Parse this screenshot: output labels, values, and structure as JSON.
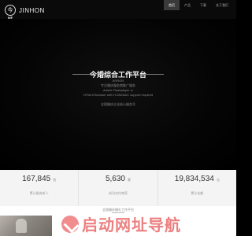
{
  "header": {
    "logo_mark": "今婚",
    "logo_text": "JINHON",
    "nav": [
      "首页",
      "产品",
      "下载",
      "关于我们"
    ]
  },
  "hero": {
    "title": "今婚综合工作平台",
    "lines": [
      "ERROR",
      "专注婚庆服务商推广服务",
      "Adobe Flashplayer or",
      "HTML5 Browser with H.264/AAC support required",
      "",
      "全国婚庆企业核心服务号"
    ]
  },
  "stats": [
    {
      "value": "167,845",
      "unit": "名",
      "label": "累计服务新人"
    },
    {
      "value": "5,630",
      "unit": "家",
      "label": "成功合作商家"
    },
    {
      "value": "19,834,534",
      "unit": "元",
      "label": "累计金额"
    }
  ],
  "section": {
    "title": "全国婚庆婚礼工作平台"
  },
  "watermark": {
    "text": "启动网址导航"
  },
  "colors": {
    "background": "#000000",
    "nav_active": "#3a3a3a",
    "stats_bg": "#f4f4f4",
    "watermark": "#e96a6a"
  }
}
